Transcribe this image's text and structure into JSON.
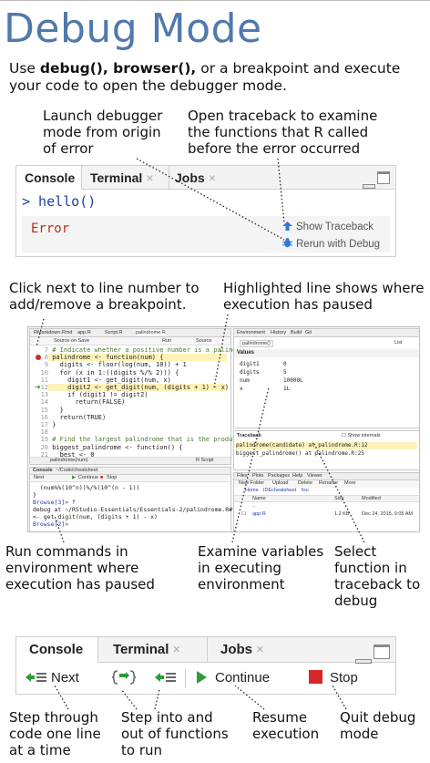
{
  "title": "Debug Mode",
  "intro": {
    "pre": "Use ",
    "bold": "debug(), browser(),",
    "post": " or a breakpoint and execute your code to open the debugger mode."
  },
  "annotations_top": {
    "launch": "Launch debugger mode from origin of error",
    "traceback": "Open traceback to examine the functions that R called before the error occurred"
  },
  "console_panel": {
    "tabs": [
      "Console",
      "Terminal",
      "Jobs"
    ],
    "prompt": "> hello()",
    "error": "Error",
    "show_traceback": "Show Traceback",
    "rerun_debug": "Rerun with Debug"
  },
  "annotations_mid": {
    "breakpoint": "Click next to line number to add/remove a breakpoint.",
    "highlight": "Highlighted line shows where execution has paused"
  },
  "ide": {
    "editor_tabs": [
      "RMarkdown.Rmd",
      "app.R",
      "Script.R",
      "palindrome.R"
    ],
    "editor_toolbar": [
      "Source on Save",
      "Run",
      "Source"
    ],
    "code_lines": [
      {
        "n": "7",
        "t": "# Indicate whether a positive number is a palindrome"
      },
      {
        "n": "8",
        "t": "palindrome <- function(num) {"
      },
      {
        "n": "9",
        "t": "  digits <- floor(log(num, 10)) + 1"
      },
      {
        "n": "10",
        "t": "  for (x in 1:((digits %/% 2))) {"
      },
      {
        "n": "11",
        "t": "    digit1 <- get_digit(num, x)"
      },
      {
        "n": "12",
        "t": "    digit2 <- get_digit(num, (digits + 1) - x)"
      },
      {
        "n": "13",
        "t": "    if (digit1 != digit2)"
      },
      {
        "n": "14",
        "t": "      return(FALSE)"
      },
      {
        "n": "15",
        "t": "  }"
      },
      {
        "n": "16",
        "t": "  return(TRUE)"
      },
      {
        "n": "17",
        "t": "}"
      },
      {
        "n": "18",
        "t": ""
      },
      {
        "n": "19",
        "t": "# Find the largest palindrome that is the product of two 3-dig"
      },
      {
        "n": "20",
        "t": "biggest_palindrome <- function() {"
      },
      {
        "n": "21",
        "t": "  best <- 0"
      }
    ],
    "editor_status": [
      "palindrome(num)",
      "R Script"
    ],
    "env_tabs": [
      "Environment",
      "History",
      "Build",
      "Git"
    ],
    "env_scope": "palindrome()",
    "env_heading": "Values",
    "env_values": [
      {
        "name": "digit1",
        "value": "0"
      },
      {
        "name": "digits",
        "value": "5"
      },
      {
        "name": "num",
        "value": "10000L"
      },
      {
        "name": "x",
        "value": "1L"
      }
    ],
    "env_list": "List",
    "traceback_label": "Traceback",
    "show_internals": "Show internals",
    "traceback_lines": [
      "palindrome(candidate) at palindrome.R:12",
      "biggest_palindrome() at palindrome.R:25"
    ],
    "console_title": "Console",
    "console_path": "~/Code/cheatsheet",
    "console_buttons": [
      "Next",
      "Continue",
      "Stop"
    ],
    "console_lines": [
      "  (num%%(10^n))%/%(10^(n - 1))",
      "}",
      "Browse[3]> f",
      "debug at ~/RStudio-Essentials/Essentials-2/palindrome.R#12: digit2",
      "<- get_digit(num, (digits + 1) - x)",
      "Browse[2]>"
    ],
    "files_tabs": [
      "Files",
      "Plots",
      "Packages",
      "Help",
      "Viewer"
    ],
    "files_toolbar": [
      "New Folder",
      "Upload",
      "Delete",
      "Rename",
      "More"
    ],
    "files_path": [
      "Home",
      "IDEcheatsheet",
      "foo"
    ],
    "files_headers": [
      "Name",
      "Size",
      "Modified"
    ],
    "files_rows": [
      {
        "name": "..",
        "size": "",
        "modified": ""
      },
      {
        "name": "app.R",
        "size": "1.2 KB",
        "modified": "Dec 24, 2015, 9:05 AM"
      }
    ]
  },
  "annotations_low": {
    "run": "Run commands in environment where execution has paused",
    "examine": "Examine variables in executing environment",
    "select": "Select function in traceback to debug"
  },
  "toolbar_panel": {
    "tabs": [
      "Console",
      "Terminal",
      "Jobs"
    ],
    "next": "Next",
    "continue": "Continue",
    "stop": "Stop"
  },
  "annotations_bottom": {
    "step": "Step through code one line at a time",
    "stepinto": "Step into and out of functions to run",
    "resume": "Resume execution",
    "quit": "Quit debug mode"
  },
  "colors": {
    "title": "#5079ad",
    "error": "#c4291c",
    "highlight": "#fdf2b8",
    "green": "#2f9a3a",
    "stop": "#d62828",
    "blue_icon": "#2b7bd6"
  }
}
